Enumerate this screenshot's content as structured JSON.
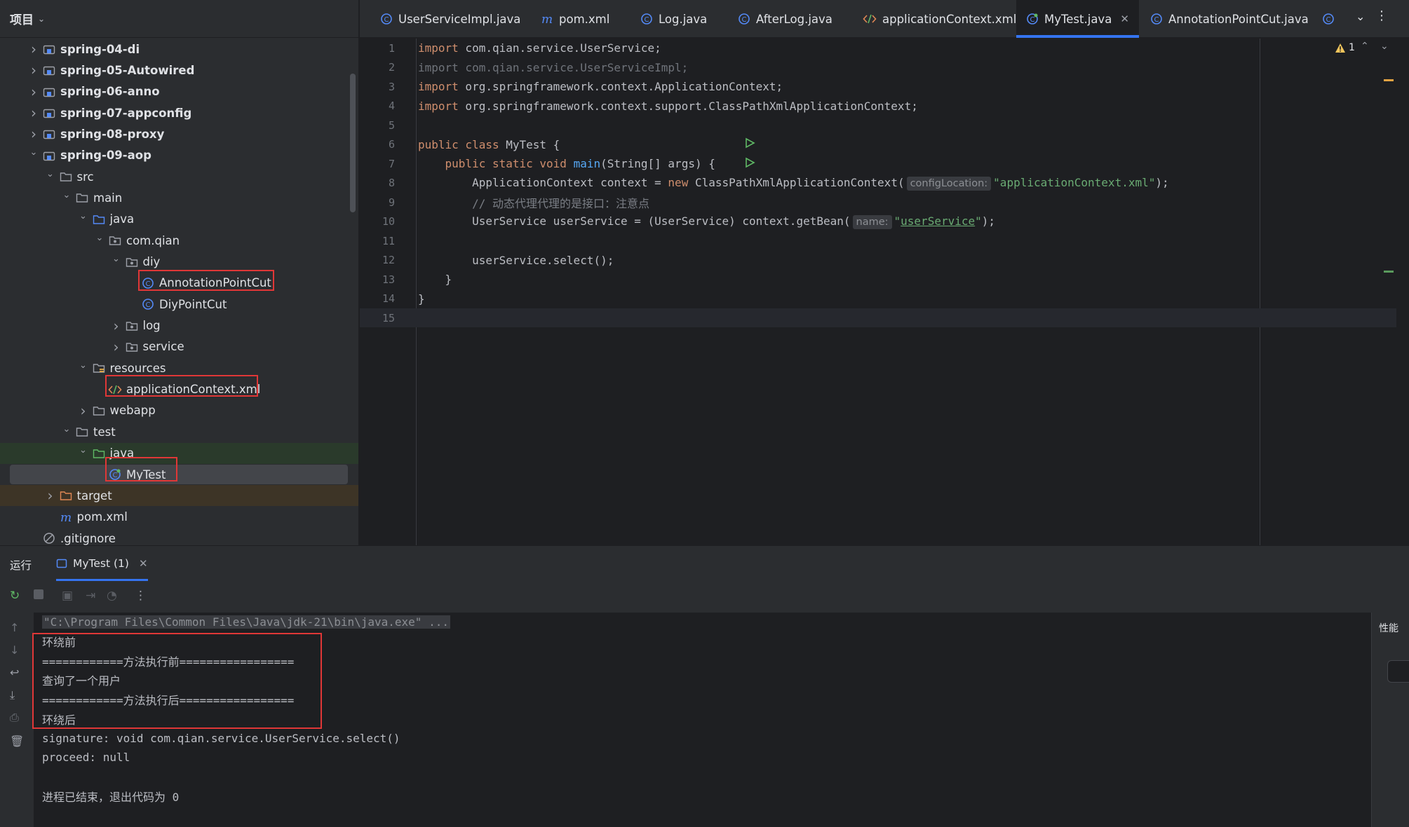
{
  "project": {
    "header": "项目",
    "tree": [
      {
        "label": "spring-04-di",
        "bold": true,
        "depth": 1,
        "expanded": false,
        "type": "module"
      },
      {
        "label": "spring-05-Autowired",
        "bold": true,
        "depth": 1,
        "expanded": false,
        "type": "module"
      },
      {
        "label": "spring-06-anno",
        "bold": true,
        "depth": 1,
        "expanded": false,
        "type": "module"
      },
      {
        "label": "spring-07-appconfig",
        "bold": true,
        "depth": 1,
        "expanded": false,
        "type": "module"
      },
      {
        "label": "spring-08-proxy",
        "bold": true,
        "depth": 1,
        "expanded": false,
        "type": "module"
      },
      {
        "label": "spring-09-aop",
        "bold": true,
        "depth": 1,
        "expanded": true,
        "type": "module"
      },
      {
        "label": "src",
        "depth": 2,
        "expanded": true,
        "type": "folder"
      },
      {
        "label": "main",
        "depth": 3,
        "expanded": true,
        "type": "folder"
      },
      {
        "label": "java",
        "depth": 4,
        "expanded": true,
        "type": "src-folder"
      },
      {
        "label": "com.qian",
        "depth": 5,
        "expanded": true,
        "type": "package"
      },
      {
        "label": "diy",
        "depth": 6,
        "expanded": true,
        "type": "package"
      },
      {
        "label": "AnnotationPointCut",
        "depth": 7,
        "type": "class"
      },
      {
        "label": "DiyPointCut",
        "depth": 7,
        "type": "class"
      },
      {
        "label": "log",
        "depth": 6,
        "expanded": false,
        "type": "package"
      },
      {
        "label": "service",
        "depth": 6,
        "expanded": false,
        "type": "package"
      },
      {
        "label": "resources",
        "depth": 4,
        "expanded": true,
        "type": "res-folder"
      },
      {
        "label": "applicationContext.xml",
        "depth": 5,
        "type": "xml"
      },
      {
        "label": "webapp",
        "depth": 4,
        "expanded": false,
        "type": "folder"
      },
      {
        "label": "test",
        "depth": 3,
        "expanded": true,
        "type": "folder"
      },
      {
        "label": "java",
        "depth": 4,
        "expanded": true,
        "type": "test-folder"
      },
      {
        "label": "MyTest",
        "depth": 5,
        "type": "test-class"
      },
      {
        "label": "target",
        "depth": 2,
        "expanded": false,
        "type": "excluded"
      },
      {
        "label": "pom.xml",
        "depth": 2,
        "type": "maven"
      },
      {
        "label": ".gitignore",
        "depth": 1,
        "type": "ignore"
      }
    ]
  },
  "tabs": [
    {
      "label": "UserServiceImpl.java",
      "icon": "class-icon"
    },
    {
      "label": "pom.xml",
      "icon": "maven-icon"
    },
    {
      "label": "Log.java",
      "icon": "class-icon"
    },
    {
      "label": "AfterLog.java",
      "icon": "class-icon"
    },
    {
      "label": "applicationContext.xml",
      "icon": "xml-icon"
    },
    {
      "label": "MyTest.java",
      "icon": "test-class-icon",
      "active": true
    },
    {
      "label": "AnnotationPointCut.java",
      "icon": "class-icon"
    }
  ],
  "editor": {
    "warning_count": "1",
    "lines": [
      "1",
      "2",
      "3",
      "4",
      "5",
      "6",
      "7",
      "8",
      "9",
      "10",
      "11",
      "12",
      "13",
      "14",
      "15"
    ],
    "code": {
      "l1_kw": "import",
      "l1": " com.qian.service.UserService;",
      "l2": "import com.qian.service.UserServiceImpl;",
      "l3_kw": "import",
      "l3": " org.springframework.context.ApplicationContext;",
      "l4_kw": "import",
      "l4": " org.springframework.context.support.ClassPathXmlApplicationContext;",
      "l6_kw": "public class",
      "l6": " MyTest {",
      "l7_indent": "    ",
      "l7_kw": "public static void",
      "l7_fn": "main",
      "l7": "(String[] args) {",
      "l8_a": "        ApplicationContext context = ",
      "l8_kw": "new",
      "l8_b": " ClassPathXmlApplicationContext(",
      "l8_hint": "configLocation:",
      "l8_str": "\"applicationContext.xml\"",
      "l8_c": ");",
      "l9": "        // 动态代理代理的是接口：注意点",
      "l10_a": "        UserService userService = (UserService) context.getBean(",
      "l10_hint": "name:",
      "l10_q1": "\"",
      "l10_str": "userService",
      "l10_q2": "\"",
      "l10_c": ");",
      "l12": "        userService.select();",
      "l13": "    }",
      "l14": "}"
    }
  },
  "run": {
    "title": "运行",
    "tab_label": "MyTest (1)",
    "perf_label": "性能",
    "output": [
      "\"C:\\Program Files\\Common Files\\Java\\jdk-21\\bin\\java.exe\" ...",
      "环绕前",
      "============方法执行前=================",
      "查询了一个用户",
      "============方法执行后=================",
      "环绕后",
      "signature: void com.qian.service.UserService.select()",
      "proceed: null",
      "",
      "进程已结束，退出代码为 0"
    ]
  },
  "colors": {
    "accent": "#3574f0",
    "highlight_box": "#e03737",
    "keyword": "#cf8e6d",
    "string": "#6aab73",
    "function": "#56a8f5"
  }
}
